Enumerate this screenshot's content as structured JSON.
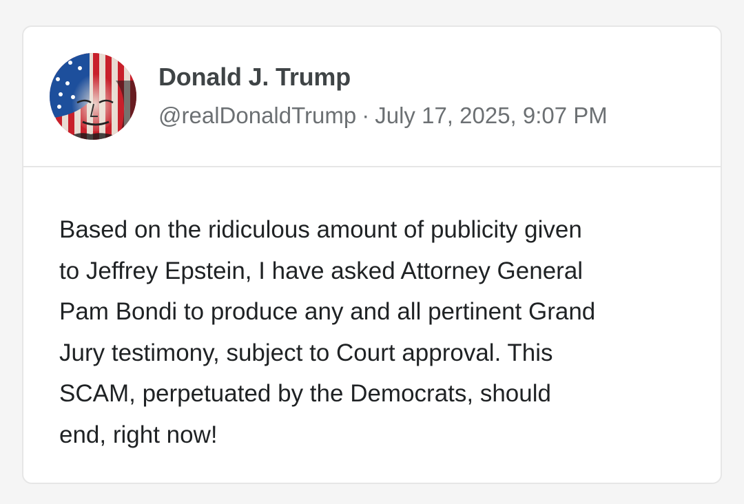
{
  "post": {
    "author": {
      "display_name": "Donald J. Trump",
      "handle": "@realDonaldTrump",
      "avatar_icon": "flag-portrait-avatar"
    },
    "separator": "·",
    "timestamp": "July 17, 2025, 9:07 PM",
    "text": "Based on the ridiculous amount of publicity given\nto Jeffrey Epstein, I have asked Attorney General\nPam Bondi to produce any and all pertinent Grand\nJury testimony, subject to Court approval. This\nSCAM, perpetuated by the Democrats, should\nend, right now!"
  },
  "colors": {
    "background": "#f5f5f5",
    "card": "#ffffff",
    "border": "#e6e6e6",
    "name_text": "#3f4446",
    "meta_text": "#6c7073",
    "body_text": "#1f2224"
  }
}
